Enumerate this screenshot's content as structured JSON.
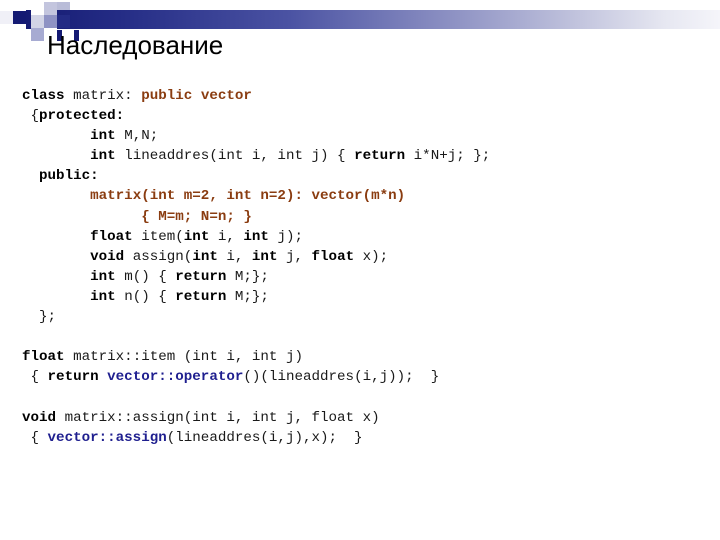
{
  "slide": {
    "title": "Наследование",
    "decoration": {
      "bar_gradient_from": "#151b73",
      "bar_gradient_to": "#f5f5fa",
      "square_dark": "#141a73",
      "square_mid": "#8f93c4",
      "square_light": "#c3c5de"
    },
    "colors": {
      "keyword": "#000000",
      "base_class": "#8a3c10",
      "scope_call": "#1f1f8f",
      "body_text": "#1a1a1a"
    },
    "code": [
      {
        "id": "line-1",
        "segments": [
          {
            "text": "class ",
            "style": "kw"
          },
          {
            "text": "matrix: ",
            "style": "plain"
          },
          {
            "text": "public vector",
            "style": "orange-b"
          }
        ]
      },
      {
        "id": "line-2",
        "segments": [
          {
            "text": " {",
            "style": "plain"
          },
          {
            "text": "protected:",
            "style": "kw"
          }
        ]
      },
      {
        "id": "line-3",
        "segments": [
          {
            "text": "        ",
            "style": "plain"
          },
          {
            "text": "int ",
            "style": "kw"
          },
          {
            "text": "M,N;",
            "style": "plain"
          }
        ]
      },
      {
        "id": "line-4",
        "segments": [
          {
            "text": "        ",
            "style": "plain"
          },
          {
            "text": "int ",
            "style": "kw"
          },
          {
            "text": "lineaddres(int i, int j) { ",
            "style": "plain"
          },
          {
            "text": "return ",
            "style": "kw"
          },
          {
            "text": "i*N+j; };",
            "style": "plain"
          }
        ]
      },
      {
        "id": "line-5",
        "segments": [
          {
            "text": "  ",
            "style": "plain"
          },
          {
            "text": "public:",
            "style": "kw"
          }
        ]
      },
      {
        "id": "line-6",
        "segments": [
          {
            "text": "        ",
            "style": "plain"
          },
          {
            "text": "matrix(int m=2, int n=2): vector(m*n)",
            "style": "orange-b"
          }
        ]
      },
      {
        "id": "line-7",
        "segments": [
          {
            "text": "              ",
            "style": "plain"
          },
          {
            "text": "{ M=m; N=n; }",
            "style": "orange-b"
          }
        ]
      },
      {
        "id": "line-8",
        "segments": [
          {
            "text": "        ",
            "style": "plain"
          },
          {
            "text": "float ",
            "style": "kw"
          },
          {
            "text": "item(",
            "style": "plain"
          },
          {
            "text": "int ",
            "style": "kw"
          },
          {
            "text": "i, ",
            "style": "plain"
          },
          {
            "text": "int ",
            "style": "kw"
          },
          {
            "text": "j);",
            "style": "plain"
          }
        ]
      },
      {
        "id": "line-9",
        "segments": [
          {
            "text": "        ",
            "style": "plain"
          },
          {
            "text": "void ",
            "style": "kw"
          },
          {
            "text": "assign(",
            "style": "plain"
          },
          {
            "text": "int ",
            "style": "kw"
          },
          {
            "text": "i, ",
            "style": "plain"
          },
          {
            "text": "int ",
            "style": "kw"
          },
          {
            "text": "j, ",
            "style": "plain"
          },
          {
            "text": "float ",
            "style": "kw"
          },
          {
            "text": "x);",
            "style": "plain"
          }
        ]
      },
      {
        "id": "line-10",
        "segments": [
          {
            "text": "        ",
            "style": "plain"
          },
          {
            "text": "int ",
            "style": "kw"
          },
          {
            "text": "m() { ",
            "style": "plain"
          },
          {
            "text": "return ",
            "style": "kw"
          },
          {
            "text": "M;};",
            "style": "plain"
          }
        ]
      },
      {
        "id": "line-11",
        "segments": [
          {
            "text": "        ",
            "style": "plain"
          },
          {
            "text": "int ",
            "style": "kw"
          },
          {
            "text": "n() { ",
            "style": "plain"
          },
          {
            "text": "return ",
            "style": "kw"
          },
          {
            "text": "M;};",
            "style": "plain"
          }
        ]
      },
      {
        "id": "line-12",
        "segments": [
          {
            "text": "  };",
            "style": "plain"
          }
        ]
      },
      {
        "id": "line-13",
        "segments": [
          {
            "text": "",
            "style": "plain"
          }
        ]
      },
      {
        "id": "line-14",
        "segments": [
          {
            "text": "float ",
            "style": "kw"
          },
          {
            "text": "matrix::item (int i, int j)",
            "style": "plain"
          }
        ]
      },
      {
        "id": "line-15",
        "segments": [
          {
            "text": " { ",
            "style": "plain"
          },
          {
            "text": "return ",
            "style": "kw"
          },
          {
            "text": "vector::operator",
            "style": "navy-b"
          },
          {
            "text": "()(lineaddres(i,j));  }",
            "style": "plain"
          }
        ]
      },
      {
        "id": "line-16",
        "segments": [
          {
            "text": "",
            "style": "plain"
          }
        ]
      },
      {
        "id": "line-17",
        "segments": [
          {
            "text": "void ",
            "style": "kw"
          },
          {
            "text": "matrix::assign(int i, int j, float x)",
            "style": "plain"
          }
        ]
      },
      {
        "id": "line-18",
        "segments": [
          {
            "text": " { ",
            "style": "plain"
          },
          {
            "text": "vector::assign",
            "style": "navy-b"
          },
          {
            "text": "(lineaddres(i,j),x);  }",
            "style": "plain"
          }
        ]
      }
    ]
  }
}
